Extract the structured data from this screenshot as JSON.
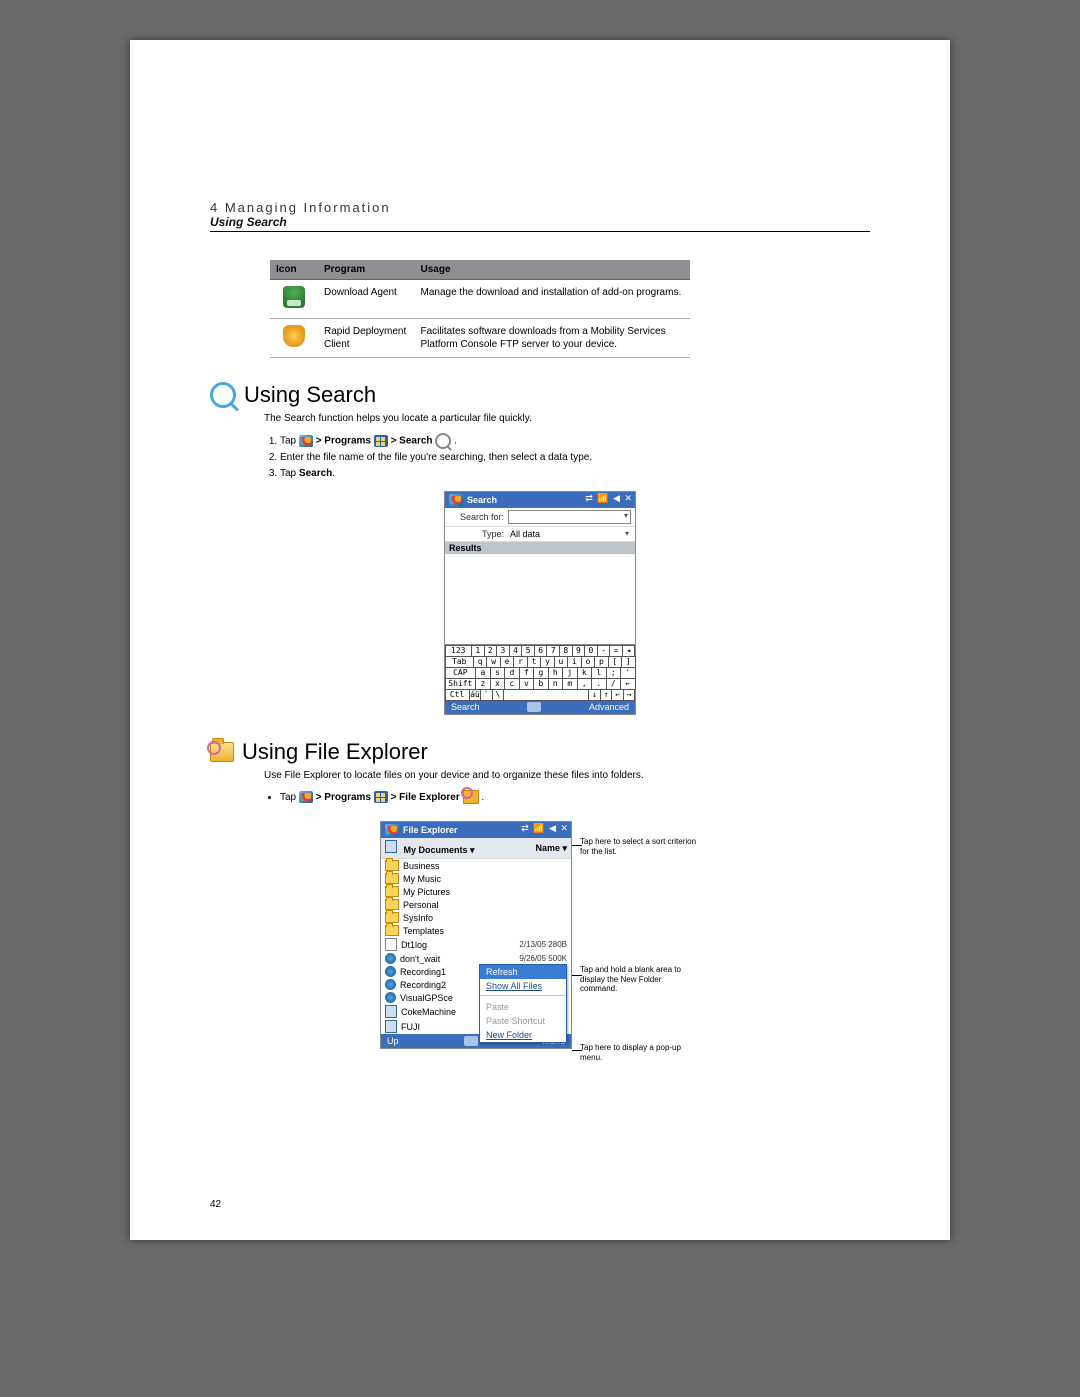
{
  "header": {
    "chapter": "4 Managing Information",
    "section": "Using Search"
  },
  "table": {
    "headers": {
      "icon": "Icon",
      "program": "Program",
      "usage": "Usage"
    },
    "rows": [
      {
        "program": "Download Agent",
        "usage": "Manage the download and installation of add-on programs."
      },
      {
        "program": "Rapid Deployment Client",
        "usage": "Facilitates software downloads from a Mobility Services Platform Console FTP server to your device."
      }
    ]
  },
  "search_section": {
    "title": "Using Search",
    "intro": "The Search function helps you locate a particular file quickly.",
    "steps": {
      "s1a": "Tap ",
      "s1b": " > Programs ",
      "s1c": " > Search ",
      "s1d": ".",
      "s2": "Enter the file name of the file you're searching, then select a data type.",
      "s3a": "Tap ",
      "s3b": "Search",
      "s3c": "."
    },
    "device": {
      "title": "Search",
      "status": "⇄  📶 ◀ ✕",
      "searchfor_label": "Search for:",
      "type_label": "Type:",
      "type_value": "All data",
      "results_header": "Results",
      "kb_r1": [
        "123",
        "1",
        "2",
        "3",
        "4",
        "5",
        "6",
        "7",
        "8",
        "9",
        "0",
        "-",
        "=",
        "◂"
      ],
      "kb_r2": [
        "Tab",
        "q",
        "w",
        "e",
        "r",
        "t",
        "y",
        "u",
        "i",
        "o",
        "p",
        "[",
        "]"
      ],
      "kb_r3": [
        "CAP",
        "a",
        "s",
        "d",
        "f",
        "g",
        "h",
        "j",
        "k",
        "l",
        ";",
        "'"
      ],
      "kb_r4": [
        "Shift",
        "z",
        "x",
        "c",
        "v",
        "b",
        "n",
        "m",
        ",",
        ".",
        "/",
        "←"
      ],
      "kb_r5": [
        "Ctl",
        "áü",
        "`",
        "\\",
        " ",
        "↓",
        "↑",
        "←",
        "→"
      ],
      "foot_left": "Search",
      "foot_right": "Advanced"
    }
  },
  "fe_section": {
    "title": "Using File Explorer",
    "intro": "Use File Explorer to locate files on your device and to organize these files into folders.",
    "step_a": "Tap ",
    "step_b": " > Programs ",
    "step_c": " > File Explorer ",
    "step_d": ".",
    "device": {
      "title": "File Explorer",
      "status": "⇄  📶 ◀ ✕",
      "crumb": "My Documents ▾",
      "sort": "Name ▾",
      "folders": [
        "Business",
        "My Music",
        "My Pictures",
        "Personal",
        "SysInfo",
        "Templates"
      ],
      "files": [
        {
          "name": "Dt1log",
          "date": "2/13/05",
          "size": "280B"
        },
        {
          "name": "don't_wait",
          "date": "9/26/05",
          "size": "500K"
        },
        {
          "name": "Recording1",
          "date": "",
          "size": ""
        },
        {
          "name": "Recording2",
          "date": "",
          "size": ""
        },
        {
          "name": "VisualGPSce",
          "date": "",
          "size": ""
        },
        {
          "name": "CokeMachine",
          "date": "",
          "size": ""
        },
        {
          "name": "FUJI",
          "date": "",
          "size": ""
        }
      ],
      "ctx": {
        "refresh": "Refresh",
        "showall": "Show All Files",
        "paste": "Paste",
        "pastes": "Paste Shortcut",
        "newf": "New Folder"
      },
      "foot_left": "Up",
      "foot_right": "Menu"
    },
    "callouts": {
      "sort": "Tap here to select a sort criterion for the list.",
      "blank": "Tap and hold a blank area to display the New Folder command.",
      "menu": "Tap here to display a pop-up menu."
    }
  },
  "page_number": "42"
}
